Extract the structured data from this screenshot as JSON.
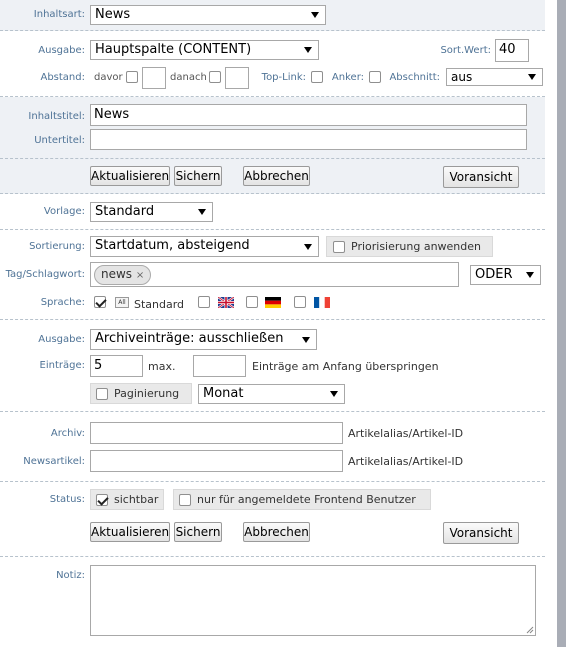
{
  "inhaltsart": {
    "label": "Inhaltsart:",
    "value": "News"
  },
  "ausgabe_section": {
    "ausgabe_label": "Ausgabe:",
    "ausgabe_value": "Hauptspalte (CONTENT)",
    "sortwert_label": "Sort.Wert:",
    "sortwert_value": "40",
    "abstand_label": "Abstand:",
    "davor_label": "davor",
    "danach_label": "danach",
    "toplink_label": "Top-Link:",
    "anker_label": "Anker:",
    "abschnitt_label": "Abschnitt:",
    "abschnitt_value": "aus"
  },
  "titles": {
    "inhaltstitel_label": "Inhaltstitel:",
    "inhaltstitel_value": "News",
    "untertitel_label": "Untertitel:",
    "untertitel_value": ""
  },
  "actions_top": {
    "aktualisieren": "Aktualisieren",
    "sichern": "Sichern",
    "abbrechen": "Abbrechen",
    "voransicht": "Voransicht"
  },
  "vorlage": {
    "label": "Vorlage:",
    "value": "Standard"
  },
  "filters": {
    "sortierung_label": "Sortierung:",
    "sortierung_value": "Startdatum, absteigend",
    "priorisierung_label": "Priorisierung anwenden",
    "tag_label": "Tag/Schlagwort:",
    "tag_chip": "news",
    "tag_chip_remove": "×",
    "tag_mode": "ODER",
    "sprache_label": "Sprache:",
    "sprache_all_badge": "All",
    "sprache_all_label": "Standard",
    "flags": [
      "uk-flag-icon",
      "germany-flag-icon",
      "france-flag-icon"
    ]
  },
  "archive": {
    "ausgabe_label": "Ausgabe:",
    "ausgabe_value": "Archiveinträge: ausschließen",
    "eintraege_label": "Einträge:",
    "eintraege_value": "5",
    "max_label": "max.",
    "skip_value": "",
    "skip_label": "Einträge am Anfang überspringen",
    "paginierung_label": "Paginierung",
    "paginierung_select": "Monat"
  },
  "links": {
    "archiv_label": "Archiv:",
    "archiv_value": "",
    "archiv_hint": "Artikelalias/Artikel-ID",
    "newsartikel_label": "Newsartikel:",
    "newsartikel_value": "",
    "newsartikel_hint": "Artikelalias/Artikel-ID"
  },
  "status": {
    "label": "Status:",
    "sichtbar_label": "sichtbar",
    "frontend_label": "nur für angemeldete Frontend Benutzer"
  },
  "actions_bottom": {
    "aktualisieren": "Aktualisieren",
    "sichern": "Sichern",
    "abbrechen": "Abbrechen",
    "voransicht": "Voransicht"
  },
  "notiz": {
    "label": "Notiz:",
    "value": ""
  },
  "colors": {
    "label_blue": "#4f7396",
    "section_grey": "#eef1f5",
    "scrollbar": "#a9adb6"
  }
}
